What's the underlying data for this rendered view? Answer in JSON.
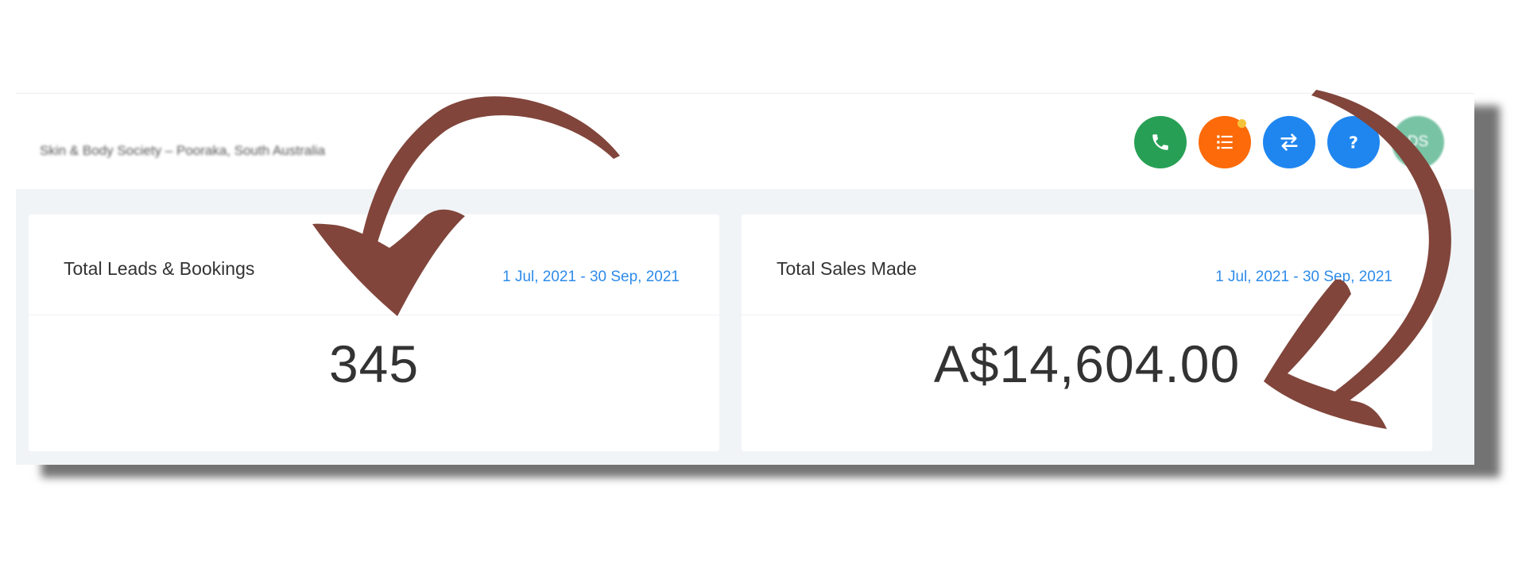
{
  "header": {
    "location": "Skin & Body Society – Pooraka, South Australia",
    "avatar_initials": "DS"
  },
  "actions": [
    {
      "name": "phone-icon"
    },
    {
      "name": "list-icon",
      "has_notification": true
    },
    {
      "name": "swap-icon"
    },
    {
      "name": "help-icon",
      "glyph": "?"
    }
  ],
  "cards": {
    "leads": {
      "title": "Total Leads & Bookings",
      "date_range": "1 Jul, 2021 - 30 Sep, 2021",
      "value": "345"
    },
    "sales": {
      "title": "Total Sales Made",
      "date_range": "1 Jul, 2021 - 30 Sep, 2021",
      "value": "A$14,604.00"
    }
  },
  "colors": {
    "phone": "#27a055",
    "list": "#fc6a09",
    "swap": "#1f86f0",
    "help": "#1f86f0",
    "avatar": "#79c3a5",
    "notification": "#f5c33b",
    "date_link": "#2d8bea",
    "arrow": "#81453b"
  }
}
